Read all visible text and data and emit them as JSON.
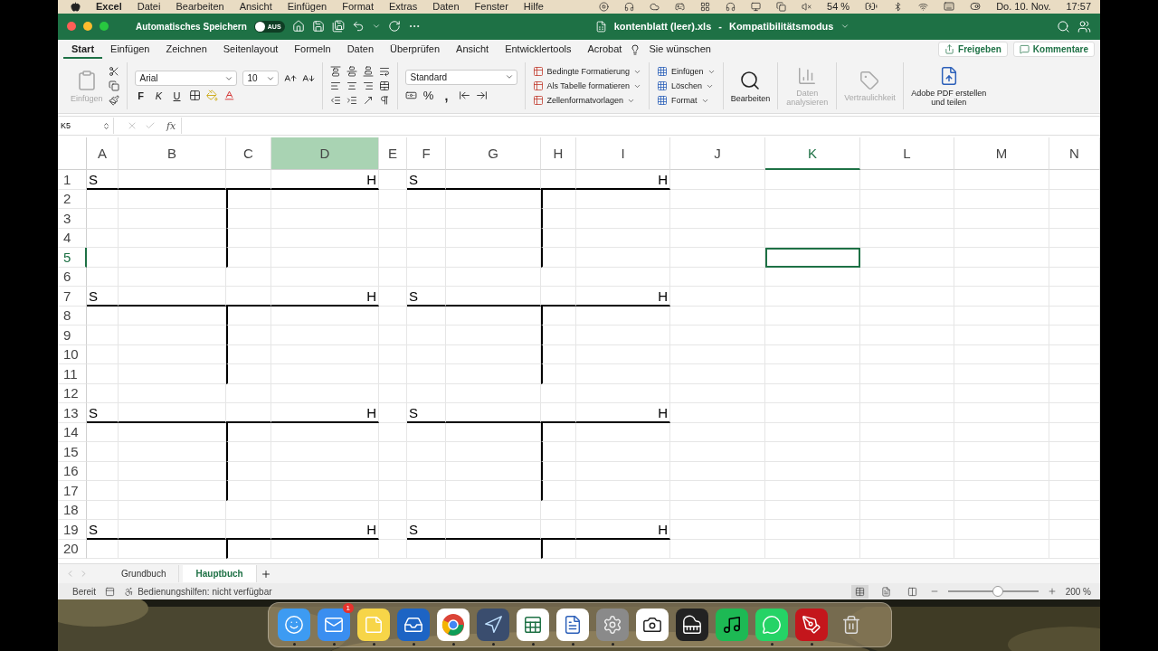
{
  "menubar": {
    "app": "Excel",
    "menus": [
      "Datei",
      "Bearbeiten",
      "Ansicht",
      "Einfügen",
      "Format",
      "Extras",
      "Daten",
      "Fenster",
      "Hilfe"
    ],
    "battery": "54 %",
    "date": "Do. 10. Nov.",
    "time": "17:57"
  },
  "titlebar": {
    "autosave_label": "Automatisches Speichern",
    "autosave": {
      "on": false,
      "label": "AUS"
    },
    "title": "kontenblatt (leer).xls",
    "separator": "-",
    "mode": "Kompatibilitätsmodus"
  },
  "ribbon_tabs": [
    {
      "label": "Start",
      "selected": true
    },
    {
      "label": "Einfügen",
      "selected": false
    },
    {
      "label": "Zeichnen",
      "selected": false
    },
    {
      "label": "Seitenlayout",
      "selected": false
    },
    {
      "label": "Formeln",
      "selected": false
    },
    {
      "label": "Daten",
      "selected": false
    },
    {
      "label": "Überprüfen",
      "selected": false
    },
    {
      "label": "Ansicht",
      "selected": false
    },
    {
      "label": "Entwicklertools",
      "selected": false
    },
    {
      "label": "Acrobat",
      "selected": false
    }
  ],
  "tell_me": "Sie wünschen",
  "share_button": "Freigeben",
  "comments_button": "Kommentare",
  "ribbon": {
    "paste_label": "Einfügen",
    "font": "Arial",
    "size": "10",
    "bold": "F",
    "italic": "K",
    "underline": "U",
    "number_format": "Standard",
    "percent": "%",
    "comma": ",",
    "styles": [
      "Bedingte Formatierung",
      "Als Tabelle formatieren",
      "Zellenformatvorlagen"
    ],
    "cells": [
      "Einfügen",
      "Löschen",
      "Format"
    ],
    "edit": "Bearbeiten",
    "analyze": {
      "label": "Daten analysieren",
      "disabled": true
    },
    "sensitivity": {
      "label": "Vertraulichkeit",
      "disabled": true
    },
    "pdf": "Adobe PDF erstellen und teilen"
  },
  "formula_bar": {
    "name_box": "K5",
    "fx": "fx"
  },
  "columns": [
    {
      "label": "A",
      "selected": false,
      "active": false
    },
    {
      "label": "B",
      "selected": false,
      "active": false
    },
    {
      "label": "C",
      "selected": false,
      "active": false
    },
    {
      "label": "D",
      "selected": true,
      "active": false
    },
    {
      "label": "E",
      "selected": false,
      "active": false
    },
    {
      "label": "F",
      "selected": false,
      "active": false
    },
    {
      "label": "G",
      "selected": false,
      "active": false
    },
    {
      "label": "H",
      "selected": false,
      "active": false
    },
    {
      "label": "I",
      "selected": false,
      "active": false
    },
    {
      "label": "J",
      "selected": false,
      "active": false
    },
    {
      "label": "K",
      "selected": false,
      "active": true
    },
    {
      "label": "L",
      "selected": false,
      "active": false
    },
    {
      "label": "M",
      "selected": false,
      "active": false
    },
    {
      "label": "N",
      "selected": false,
      "active": false
    }
  ],
  "rows": [
    {
      "label": "1",
      "kind": "header",
      "active": false,
      "accounts": [
        {
          "debit": "S",
          "credit": "H"
        },
        {
          "debit": "S",
          "credit": "H"
        }
      ]
    },
    {
      "label": "2",
      "kind": "body",
      "active": false
    },
    {
      "label": "3",
      "kind": "body",
      "active": false
    },
    {
      "label": "4",
      "kind": "body",
      "active": false
    },
    {
      "label": "5",
      "kind": "body",
      "active": true
    },
    {
      "label": "6",
      "kind": "blank",
      "active": false
    },
    {
      "label": "7",
      "kind": "header",
      "active": false,
      "accounts": [
        {
          "debit": "S",
          "credit": "H"
        },
        {
          "debit": "S",
          "credit": "H"
        }
      ]
    },
    {
      "label": "8",
      "kind": "body",
      "active": false
    },
    {
      "label": "9",
      "kind": "body",
      "active": false
    },
    {
      "label": "10",
      "kind": "body",
      "active": false
    },
    {
      "label": "11",
      "kind": "body",
      "active": false
    },
    {
      "label": "12",
      "kind": "blank",
      "active": false
    },
    {
      "label": "13",
      "kind": "header",
      "active": false,
      "accounts": [
        {
          "debit": "S",
          "credit": "H"
        },
        {
          "debit": "S",
          "credit": "H"
        }
      ]
    },
    {
      "label": "14",
      "kind": "body",
      "active": false
    },
    {
      "label": "15",
      "kind": "body",
      "active": false
    },
    {
      "label": "16",
      "kind": "body",
      "active": false
    },
    {
      "label": "17",
      "kind": "body",
      "active": false
    },
    {
      "label": "18",
      "kind": "blank",
      "active": false
    },
    {
      "label": "19",
      "kind": "header",
      "active": false,
      "accounts": [
        {
          "debit": "S",
          "credit": "H"
        },
        {
          "debit": "S",
          "credit": "H"
        }
      ]
    },
    {
      "label": "20",
      "kind": "body",
      "active": false
    }
  ],
  "sheets": [
    {
      "label": "Grundbuch",
      "selected": false
    },
    {
      "label": "Hauptbuch",
      "selected": true
    }
  ],
  "status_bar": {
    "ready": "Bereit",
    "accessibility": "Bedienungshilfen: nicht verfügbar",
    "views": [
      {
        "kind": "normal",
        "selected": true
      },
      {
        "kind": "layout",
        "selected": false
      },
      {
        "kind": "pagebreak",
        "selected": false
      }
    ],
    "zoom": {
      "level": 0.55
    },
    "zoom_label": "200 %"
  },
  "dock": [
    {
      "kind": "finder",
      "running": true
    },
    {
      "kind": "mail",
      "running": true,
      "badge": "1"
    },
    {
      "kind": "notes",
      "running": true
    },
    {
      "kind": "outlook",
      "running": true
    },
    {
      "kind": "chrome",
      "running": true
    },
    {
      "kind": "arrow",
      "running": true
    },
    {
      "kind": "excel",
      "running": true
    },
    {
      "kind": "word",
      "running": true
    },
    {
      "kind": "settings",
      "running": true
    },
    {
      "kind": "camera",
      "running": false
    },
    {
      "kind": "piano",
      "running": false
    },
    {
      "kind": "music",
      "running": false
    },
    {
      "kind": "chat",
      "running": true
    },
    {
      "kind": "acrobat",
      "running": true
    },
    {
      "kind": "trash",
      "running": false
    }
  ]
}
